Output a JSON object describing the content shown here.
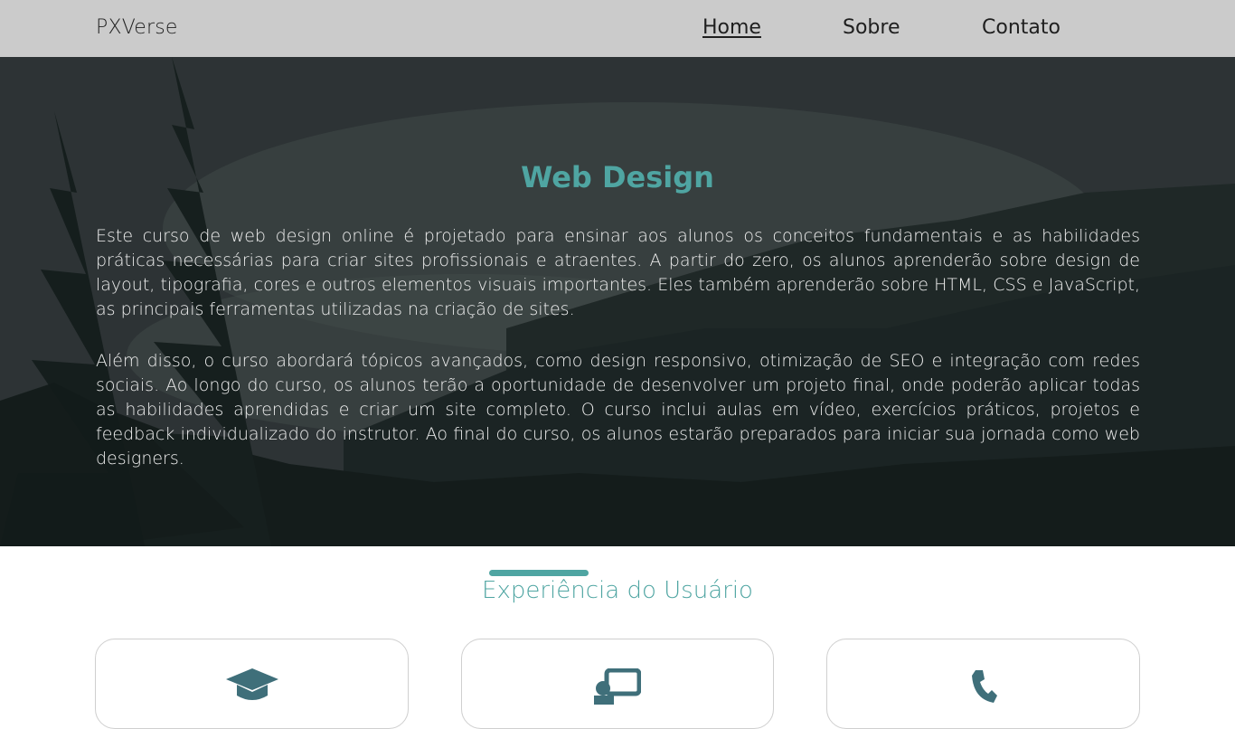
{
  "header": {
    "brand": "PXVerse",
    "nav": [
      {
        "label": "Home",
        "active": true
      },
      {
        "label": "Sobre",
        "active": false
      },
      {
        "label": "Contato",
        "active": false
      }
    ]
  },
  "hero": {
    "title": "Web Design",
    "paragraphs": [
      "Este curso de web design online é projetado para ensinar aos alunos os conceitos fundamentais e as habilidades práticas necessárias para criar sites profissionais e atraentes. A partir do zero, os alunos aprenderão sobre design de layout, tipografia, cores e outros elementos visuais importantes. Eles também aprenderão sobre HTML, CSS e JavaScript, as principais ferramentas utilizadas na criação de sites.",
      "Além disso, o curso abordará tópicos avançados, como design responsivo, otimização de SEO e integração com redes sociais. Ao longo do curso, os alunos terão a oportunidade de desenvolver um projeto final, onde poderão aplicar todas as habilidades aprendidas e criar um site completo. O curso inclui aulas em vídeo, exercícios práticos, projetos e feedback individualizado do instrutor. Ao final do curso, os alunos estarão preparados para iniciar sua jornada como web designers."
    ]
  },
  "section": {
    "title": "Experiência do Usuário",
    "cards": [
      {
        "icon": "graduation-cap-icon"
      },
      {
        "icon": "chalkboard-teacher-icon"
      },
      {
        "icon": "phone-icon"
      }
    ]
  },
  "colors": {
    "accent": "#4fa5a2",
    "header_bg": "#cbcbcb",
    "text_dark": "#1f1f1f"
  }
}
